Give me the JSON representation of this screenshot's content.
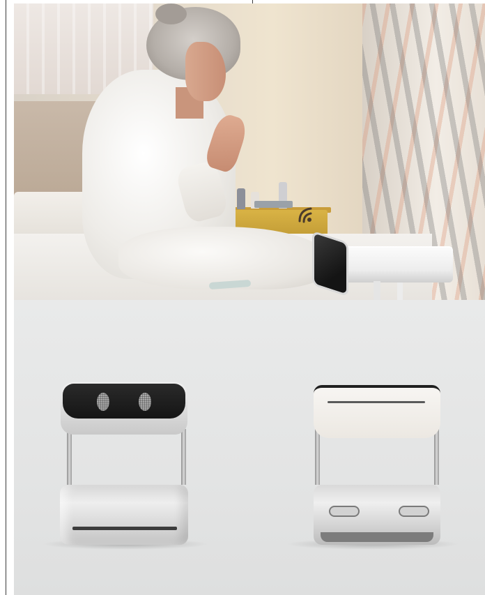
{
  "scene": {
    "photo": {
      "subject": "elderly-woman-waving-at-device"
    },
    "product_views": [
      "front-view",
      "back-view"
    ]
  },
  "icons": {
    "wifi_gesture": "wifi-icon"
  },
  "colors": {
    "background": "#ffffff",
    "panel_gray": "#e5e6e6",
    "device_screen": "#1a1a1a",
    "nightstand": "#c99d3a"
  }
}
